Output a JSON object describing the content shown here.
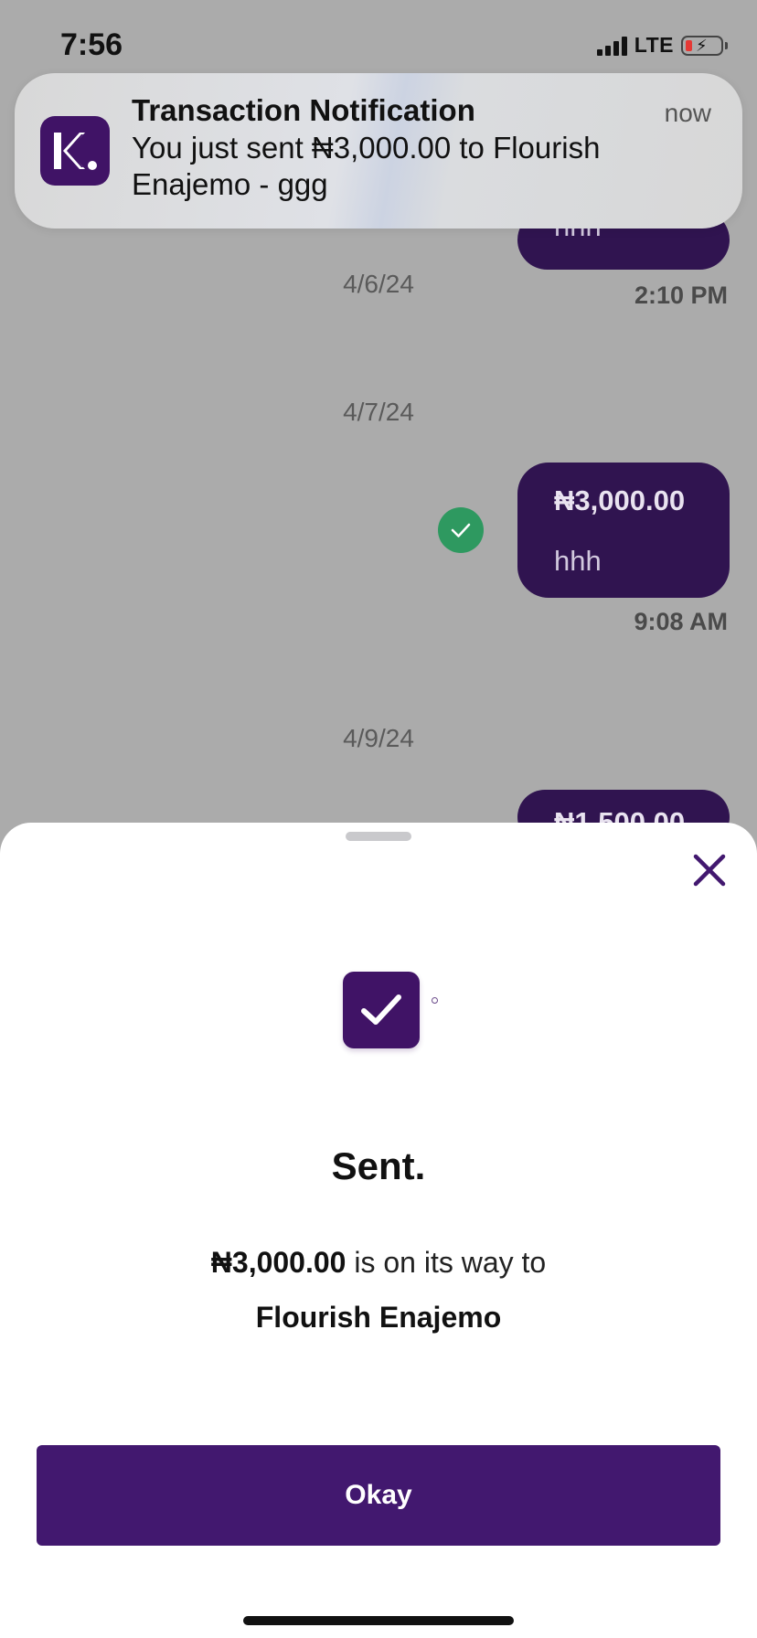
{
  "status_bar": {
    "time": "7:56",
    "network": "LTE"
  },
  "chat": {
    "partial_note_top": "hhh",
    "top_time": "2:10 PM",
    "dates": [
      "4/6/24",
      "4/7/24",
      "4/9/24"
    ],
    "message": {
      "amount": "₦3,000.00",
      "note": "hhh",
      "time": "9:08 AM"
    },
    "partial_amount_bottom": "₦1,500.00"
  },
  "notification": {
    "title": "Transaction Notification",
    "time": "now",
    "body": "You just sent ₦3,000.00 to Flourish Enajemo - ggg"
  },
  "sheet": {
    "title": "Sent.",
    "amount": "₦3,000.00",
    "message": " is on its way to",
    "recipient": "Flourish Enajemo",
    "button_label": "Okay"
  },
  "colors": {
    "brand": "#42186f",
    "success": "#2e9960",
    "bubble": "#301450"
  }
}
